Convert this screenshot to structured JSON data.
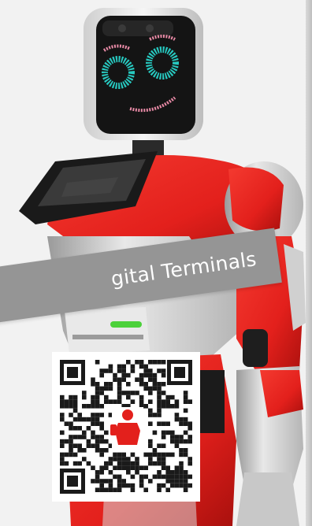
{
  "banner": {
    "text": "gital Terminals"
  },
  "robot": {
    "face_colors": {
      "eyes": "#27c9c0",
      "mouth": "#e88aa6",
      "screen": "#141414"
    },
    "body_colors": {
      "red": "#e3201c",
      "white": "#d9d9d9",
      "dark": "#1c1c1c"
    }
  },
  "qr": {
    "logo_icon": "robot-silhouette-icon",
    "logo_color": "#e3201c"
  },
  "colors": {
    "background": "#f2f2f2",
    "banner": "#959595",
    "qr_dark": "#1a1a1a"
  }
}
